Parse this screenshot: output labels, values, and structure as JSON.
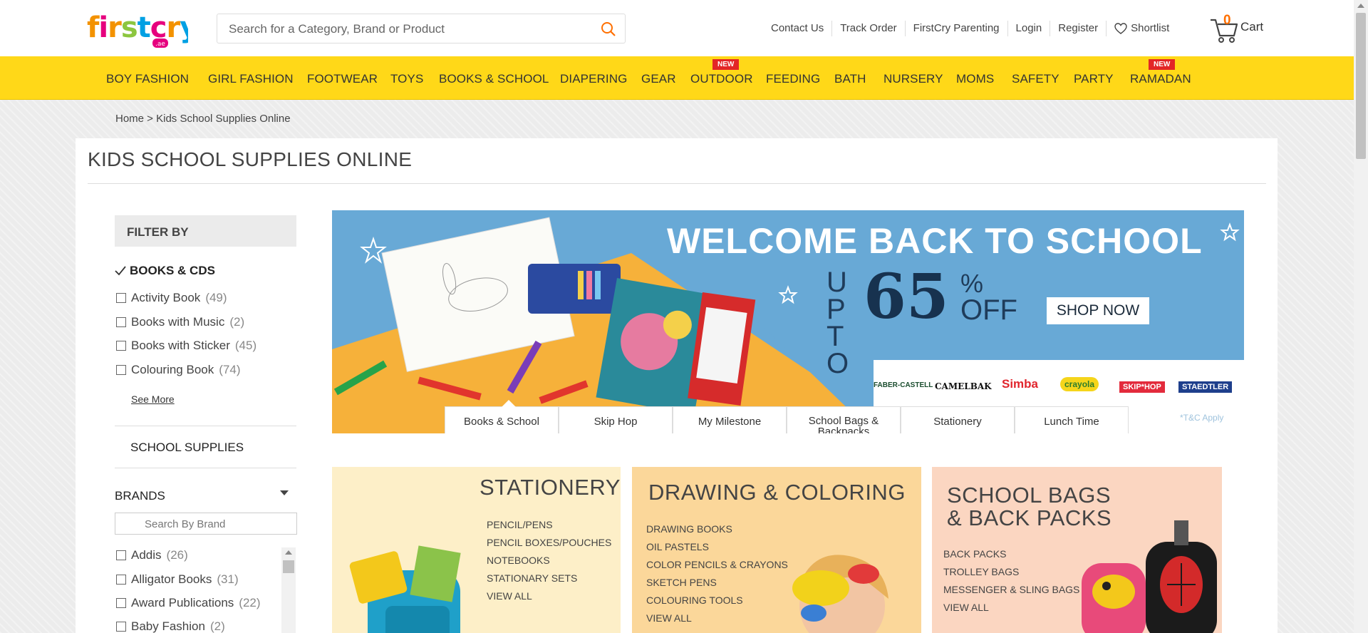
{
  "brand": {
    "logo_text": "firstcry",
    "logo_sub": ".ae"
  },
  "search": {
    "placeholder": "Search for a Category, Brand or Product"
  },
  "toplinks": [
    "Contact Us",
    "Track Order",
    "FirstCry Parenting",
    "Login",
    "Register",
    "Shortlist"
  ],
  "cart": {
    "count": "0",
    "label": "Cart"
  },
  "nav": {
    "items": [
      "BOY FASHION",
      "GIRL FASHION",
      "FOOTWEAR",
      "TOYS",
      "BOOKS & SCHOOL",
      "DIAPERING",
      "GEAR",
      "OUTDOOR",
      "FEEDING",
      "BATH",
      "NURSERY",
      "MOMS",
      "SAFETY",
      "PARTY",
      "RAMADAN"
    ],
    "new_badge": "NEW"
  },
  "breadcrumb": "Home > Kids School Supplies Online",
  "page_title": "KIDS SCHOOL SUPPLIES ONLINE",
  "sidebar": {
    "filter_by": "FILTER BY",
    "books_cds": {
      "title": "BOOKS & CDS",
      "items": [
        {
          "label": "Activity Book",
          "count": "(49)"
        },
        {
          "label": "Books with Music",
          "count": "(2)"
        },
        {
          "label": "Books with Sticker",
          "count": "(45)"
        },
        {
          "label": "Colouring Book",
          "count": "(74)"
        }
      ],
      "see_more": "See More"
    },
    "school_supplies": "SCHOOL SUPPLIES",
    "brands": {
      "title": "BRANDS",
      "search_placeholder": "Search By Brand",
      "items": [
        {
          "label": "Addis",
          "count": "(26)"
        },
        {
          "label": "Alligator Books",
          "count": "(31)"
        },
        {
          "label": "Award Publications",
          "count": "(22)"
        },
        {
          "label": "Baby Fashion",
          "count": "(2)"
        }
      ]
    }
  },
  "banner": {
    "title": "WELCOME BACK TO SCHOOL",
    "upto": "UP TO",
    "percent": "65",
    "percent_sign": "%",
    "off": "OFF",
    "cta": "SHOP NOW",
    "brands": [
      "FABER-CASTELL",
      "CAMELBAK",
      "Simba",
      "crayola",
      "SKIP*HOP",
      "STAEDTLER"
    ],
    "terms": "*T&C Apply",
    "tabs": [
      "Books & School",
      "Skip Hop",
      "My Milestone",
      "School Bags & Backpacks",
      "Stationery",
      "Lunch Time"
    ]
  },
  "categories": [
    {
      "title": "STATIONERY",
      "links": [
        "PENCIL/PENS",
        "PENCIL BOXES/POUCHES",
        "NOTEBOOKS",
        "STATIONARY SETS",
        "VIEW ALL"
      ]
    },
    {
      "title": "DRAWING & COLORING",
      "links": [
        "DRAWING BOOKS",
        "OIL PASTELS",
        "COLOR PENCILS & CRAYONS",
        "SKETCH PENS",
        "COLOURING TOOLS",
        "VIEW ALL"
      ]
    },
    {
      "title": "SCHOOL BAGS & BACK PACKS",
      "title_line1": "SCHOOL BAGS",
      "title_line2": "& BACK PACKS",
      "links": [
        "BACK PACKS",
        "TROLLEY BAGS",
        "MESSENGER & SLING BAGS",
        "VIEW ALL"
      ]
    }
  ],
  "colors": {
    "nav_yellow": "#ffd818",
    "new_badge": "#e32626",
    "banner_blue": "#68a9d6",
    "banner_orange": "#f6b13a",
    "accent_orange": "#ff6f00"
  }
}
